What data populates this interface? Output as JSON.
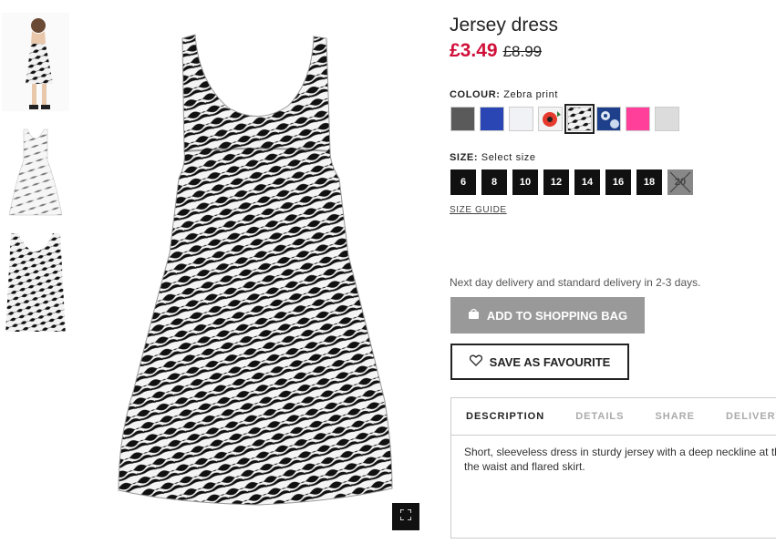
{
  "product": {
    "title": "Jersey dress",
    "price_now": "£3.49",
    "price_old": "£8.99"
  },
  "colour": {
    "label": "COLOUR:",
    "selected": "Zebra print",
    "swatches": [
      {
        "name": "dark-grey",
        "color": "#5a5a5a"
      },
      {
        "name": "blue",
        "color": "#2a46b5"
      },
      {
        "name": "white",
        "color": "#f1f2f6"
      },
      {
        "name": "red-floral",
        "color": "#e53a2c"
      },
      {
        "name": "zebra",
        "color": "#222222"
      },
      {
        "name": "blue-floral",
        "color": "#1e3f8a"
      },
      {
        "name": "pink",
        "color": "#ff3f9a"
      },
      {
        "name": "light-grey",
        "color": "#dcdcdc"
      }
    ]
  },
  "size": {
    "label": "SIZE:",
    "hint": "Select size",
    "options": [
      "6",
      "8",
      "10",
      "12",
      "14",
      "16",
      "18",
      "20"
    ],
    "guide": "SIZE GUIDE"
  },
  "delivery": "Next day delivery and standard delivery in 2-3 days.",
  "buttons": {
    "add_to_bag": "ADD TO SHOPPING BAG",
    "save_favourite": "SAVE AS FAVOURITE"
  },
  "tabs": [
    "DESCRIPTION",
    "DETAILS",
    "SHARE",
    "DELIVERY"
  ],
  "description": [
    "Short, sleeveless dress in sturdy jersey with a deep neckline at th",
    "the waist and flared skirt."
  ],
  "icons": {
    "expand": "expand-icon",
    "bag": "bag-icon",
    "heart": "heart-icon"
  }
}
